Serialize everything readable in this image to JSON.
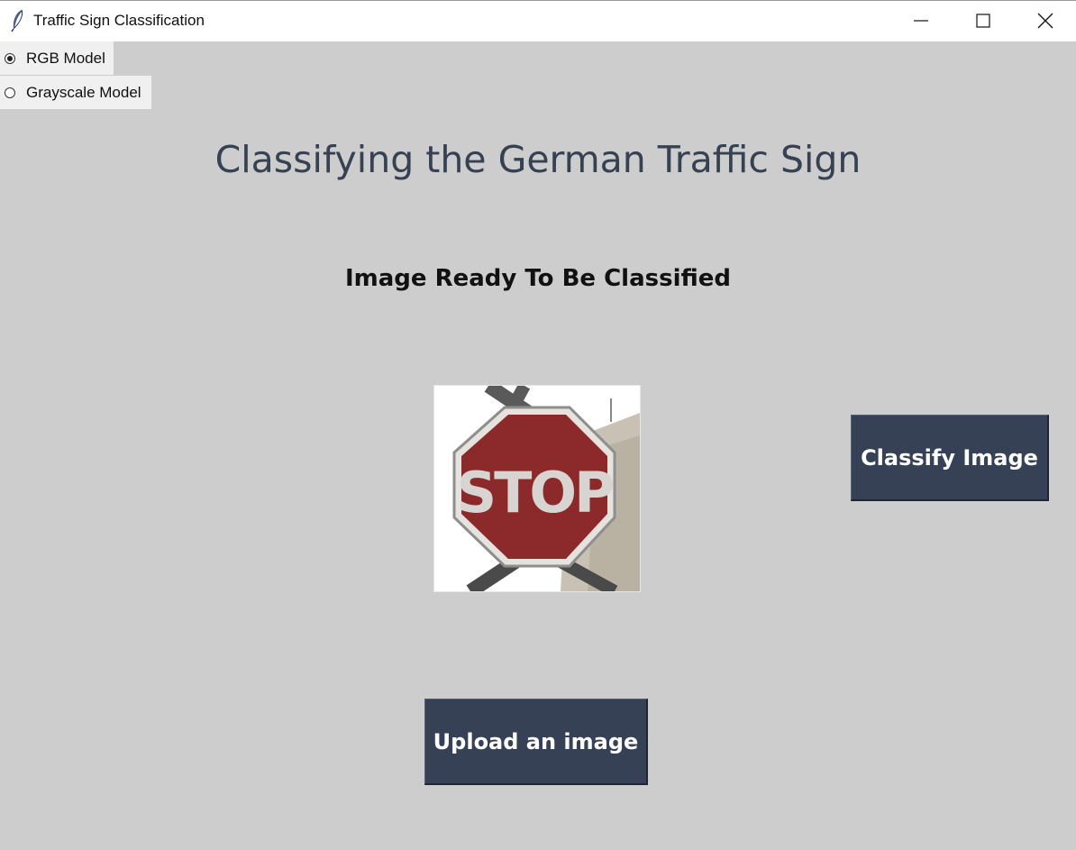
{
  "window": {
    "title": "Traffic Sign Classification",
    "icon": "feather-icon"
  },
  "model_options": {
    "rgb_label": "RGB Model",
    "grayscale_label": "Grayscale Model",
    "selected": "RGB Model"
  },
  "main": {
    "heading": "Classifying the German Traffic Sign",
    "status": "Image Ready To Be Classified",
    "sign_text": "STOP",
    "classify_label": "Classify Image",
    "upload_label": "Upload an image"
  },
  "colors": {
    "background": "#cdcdcd",
    "heading": "#364152",
    "button": "#364156",
    "stop_red": "#8c2a2b"
  }
}
